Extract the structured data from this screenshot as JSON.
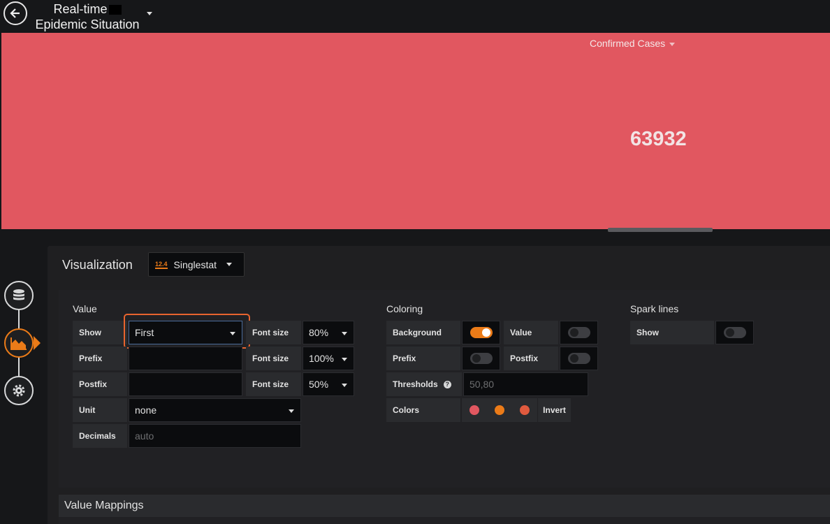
{
  "header": {
    "title_line1": "Real-time",
    "title_line2": "Epidemic Situation"
  },
  "panel": {
    "title": "Confirmed Cases",
    "value": "63932",
    "background_color": "#e15760"
  },
  "editor": {
    "section_label": "Visualization",
    "viz_type": "Singlestat",
    "viz_icon_text": "12.4"
  },
  "value_section": {
    "title": "Value",
    "show_label": "Show",
    "show_value": "First",
    "prefix_label": "Prefix",
    "prefix_value": "",
    "postfix_label": "Postfix",
    "postfix_value": "",
    "unit_label": "Unit",
    "unit_value": "none",
    "decimals_label": "Decimals",
    "decimals_placeholder": "auto",
    "font_size_label": "Font size",
    "font_size_value_1": "80%",
    "font_size_value_2": "100%",
    "font_size_value_3": "50%"
  },
  "coloring_section": {
    "title": "Coloring",
    "background_label": "Background",
    "background_on": true,
    "value_label": "Value",
    "value_on": false,
    "prefix_label": "Prefix",
    "prefix_on": false,
    "postfix_label": "Postfix",
    "postfix_on": false,
    "thresholds_label": "Thresholds",
    "thresholds_value": "50,80",
    "colors_label": "Colors",
    "colors": [
      "#e15760",
      "#eb7b18",
      "#e05a3e"
    ],
    "invert_label": "Invert"
  },
  "sparklines_section": {
    "title": "Spark lines",
    "show_label": "Show",
    "show_on": false
  },
  "mappings": {
    "title": "Value Mappings"
  }
}
